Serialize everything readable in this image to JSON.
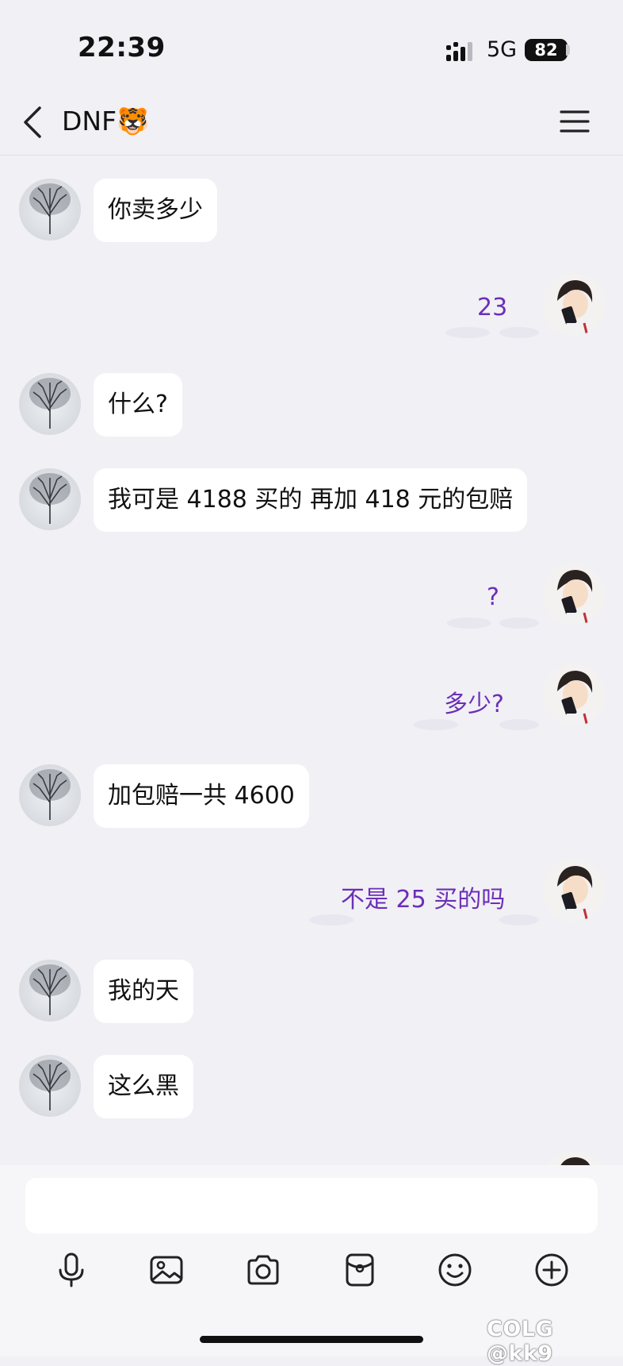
{
  "status_bar": {
    "time": "22:39",
    "network": "5G",
    "battery": "82"
  },
  "nav": {
    "title": "DNF🐯"
  },
  "messages": [
    {
      "side": "left",
      "text": "你卖多少"
    },
    {
      "side": "right",
      "text": "23"
    },
    {
      "side": "left",
      "text": "什么?"
    },
    {
      "side": "left",
      "text": "我可是 4188 买的 再加 418 元的包赔"
    },
    {
      "side": "right",
      "text": "?"
    },
    {
      "side": "right",
      "text": "多少?"
    },
    {
      "side": "left",
      "text": "加包赔一共 4600"
    },
    {
      "side": "right",
      "text": "不是 25 买的吗"
    },
    {
      "side": "left",
      "text": "我的天"
    },
    {
      "side": "left",
      "text": "这么黑"
    }
  ],
  "input": {
    "placeholder": ""
  },
  "toolbar": [
    "microphone-icon",
    "image-icon",
    "camera-icon",
    "red-packet-icon",
    "emoji-icon",
    "plus-icon"
  ],
  "watermark": "COLG @kk9",
  "colors": {
    "self_text": "#6b2fb8",
    "background": "#f1f0f5",
    "bubble": "#ffffff"
  }
}
